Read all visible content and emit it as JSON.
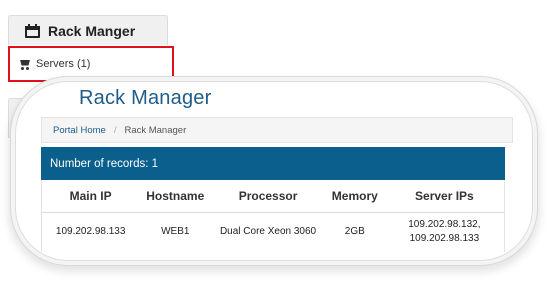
{
  "sidebar": {
    "panel_title": "Rack Manger",
    "servers_item_label": "Servers (1)"
  },
  "page": {
    "title": "Rack Manager",
    "breadcrumb": [
      "Portal Home",
      "Rack Manager"
    ],
    "records_text": "Number of records: 1"
  },
  "table": {
    "headers": [
      "Main IP",
      "Hostname",
      "Processor",
      "Memory",
      "Server IPs"
    ],
    "rows": [
      {
        "main_ip": "109.202.98.133",
        "hostname": "WEB1",
        "processor": "Dual Core Xeon 3060",
        "memory": "2GB",
        "server_ips": [
          "109.202.98.132,",
          "109.202.98.133"
        ]
      }
    ]
  },
  "colors": {
    "accent_blue": "#0a5f8d",
    "title_blue": "#1f5c8a",
    "highlight_red": "#e0111d"
  },
  "icons": {
    "panel_icon": "calendar-icon",
    "servers_icon": "shopping-cart-icon"
  }
}
